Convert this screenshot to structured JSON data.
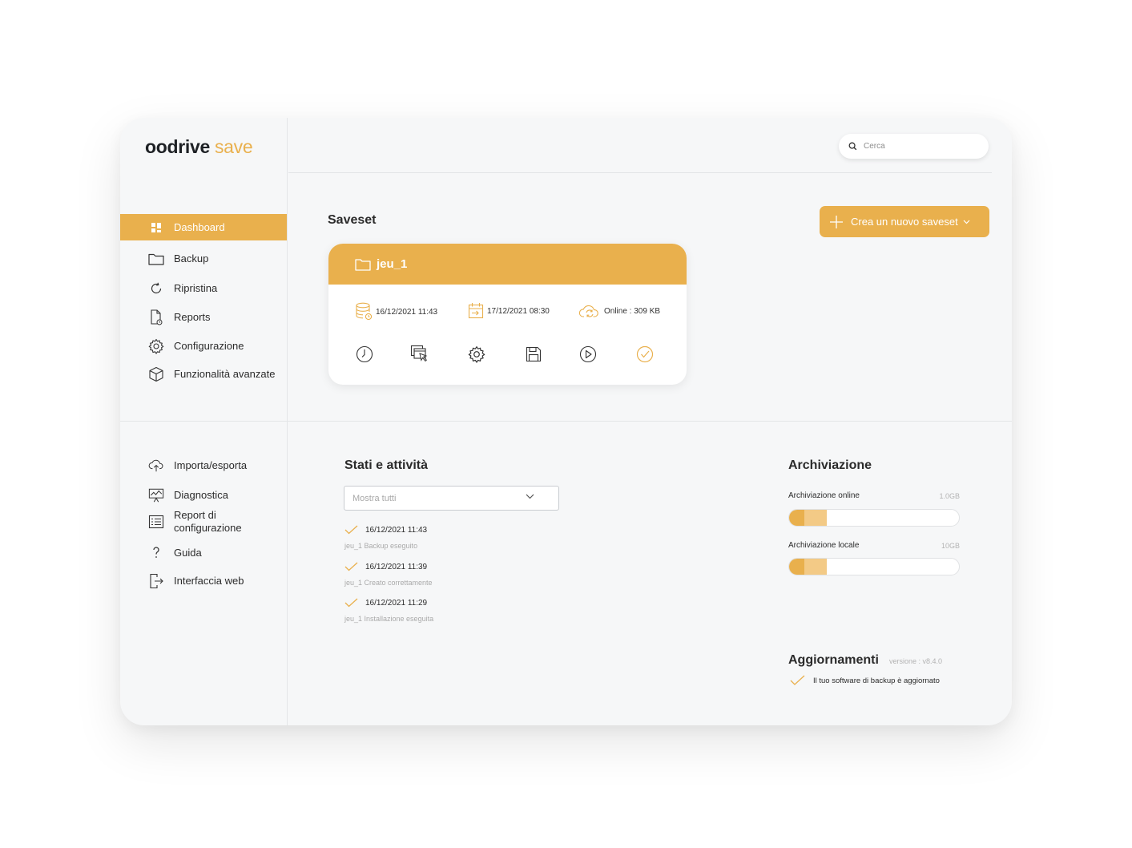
{
  "app": {
    "brand": "oodrive",
    "product": "save"
  },
  "search": {
    "placeholder": "Cerca"
  },
  "sidebar": {
    "primary": [
      {
        "label": "Dashboard",
        "icon": "dashboard-icon",
        "active": true
      },
      {
        "label": "Backup",
        "icon": "folder-icon"
      },
      {
        "label": "Ripristina",
        "icon": "restore-icon"
      },
      {
        "label": "Reports",
        "icon": "report-icon"
      },
      {
        "label": "Configurazione",
        "icon": "gear-icon"
      },
      {
        "label": "Funzionalità avanzate",
        "icon": "cube-icon"
      }
    ],
    "secondary": [
      {
        "label": "Importa/esporta",
        "icon": "cloud-upload-icon"
      },
      {
        "label": "Diagnostica",
        "icon": "monitor-icon"
      },
      {
        "label": "Report di configurazione",
        "icon": "list-icon"
      },
      {
        "label": "Guida",
        "icon": "question-icon"
      },
      {
        "label": "Interfaccia web",
        "icon": "logout-icon"
      }
    ]
  },
  "saveset": {
    "title": "Saveset",
    "create_button": "Crea un nuovo saveset",
    "card": {
      "name": "jeu_1",
      "last_backup": "16/12/2021 11:43",
      "next_backup": "17/12/2021 08:30",
      "online": "Online : 309 KB",
      "actions": [
        "clock-icon",
        "window-select-icon",
        "gear-icon",
        "save-icon",
        "play-icon",
        "check-circle-icon"
      ]
    }
  },
  "activity": {
    "title": "Stati e attività",
    "filter_value": "Mostra tutti",
    "events": [
      {
        "date": "16/12/2021 11:43",
        "desc": "jeu_1 Backup eseguito"
      },
      {
        "date": "16/12/2021 11:39",
        "desc": "jeu_1 Creato correttamente"
      },
      {
        "date": "16/12/2021 11:29",
        "desc": "jeu_1 Installazione eseguita"
      }
    ]
  },
  "storage": {
    "title": "Archiviazione",
    "items": [
      {
        "label": "Archiviazione online",
        "size": "1.0GB",
        "fill_primary": 0.09,
        "fill_secondary": 0.22
      },
      {
        "label": "Archiviazione locale",
        "size": "10GB",
        "fill_primary": 0.09,
        "fill_secondary": 0.22
      }
    ]
  },
  "updates": {
    "title": "Aggiornamenti",
    "version": "versione : v8.4.0",
    "status": "Il tuo software di backup è aggiornato"
  },
  "colors": {
    "accent": "#e9b04d",
    "accent_light": "#f3ca86",
    "background": "#f6f7f8"
  }
}
